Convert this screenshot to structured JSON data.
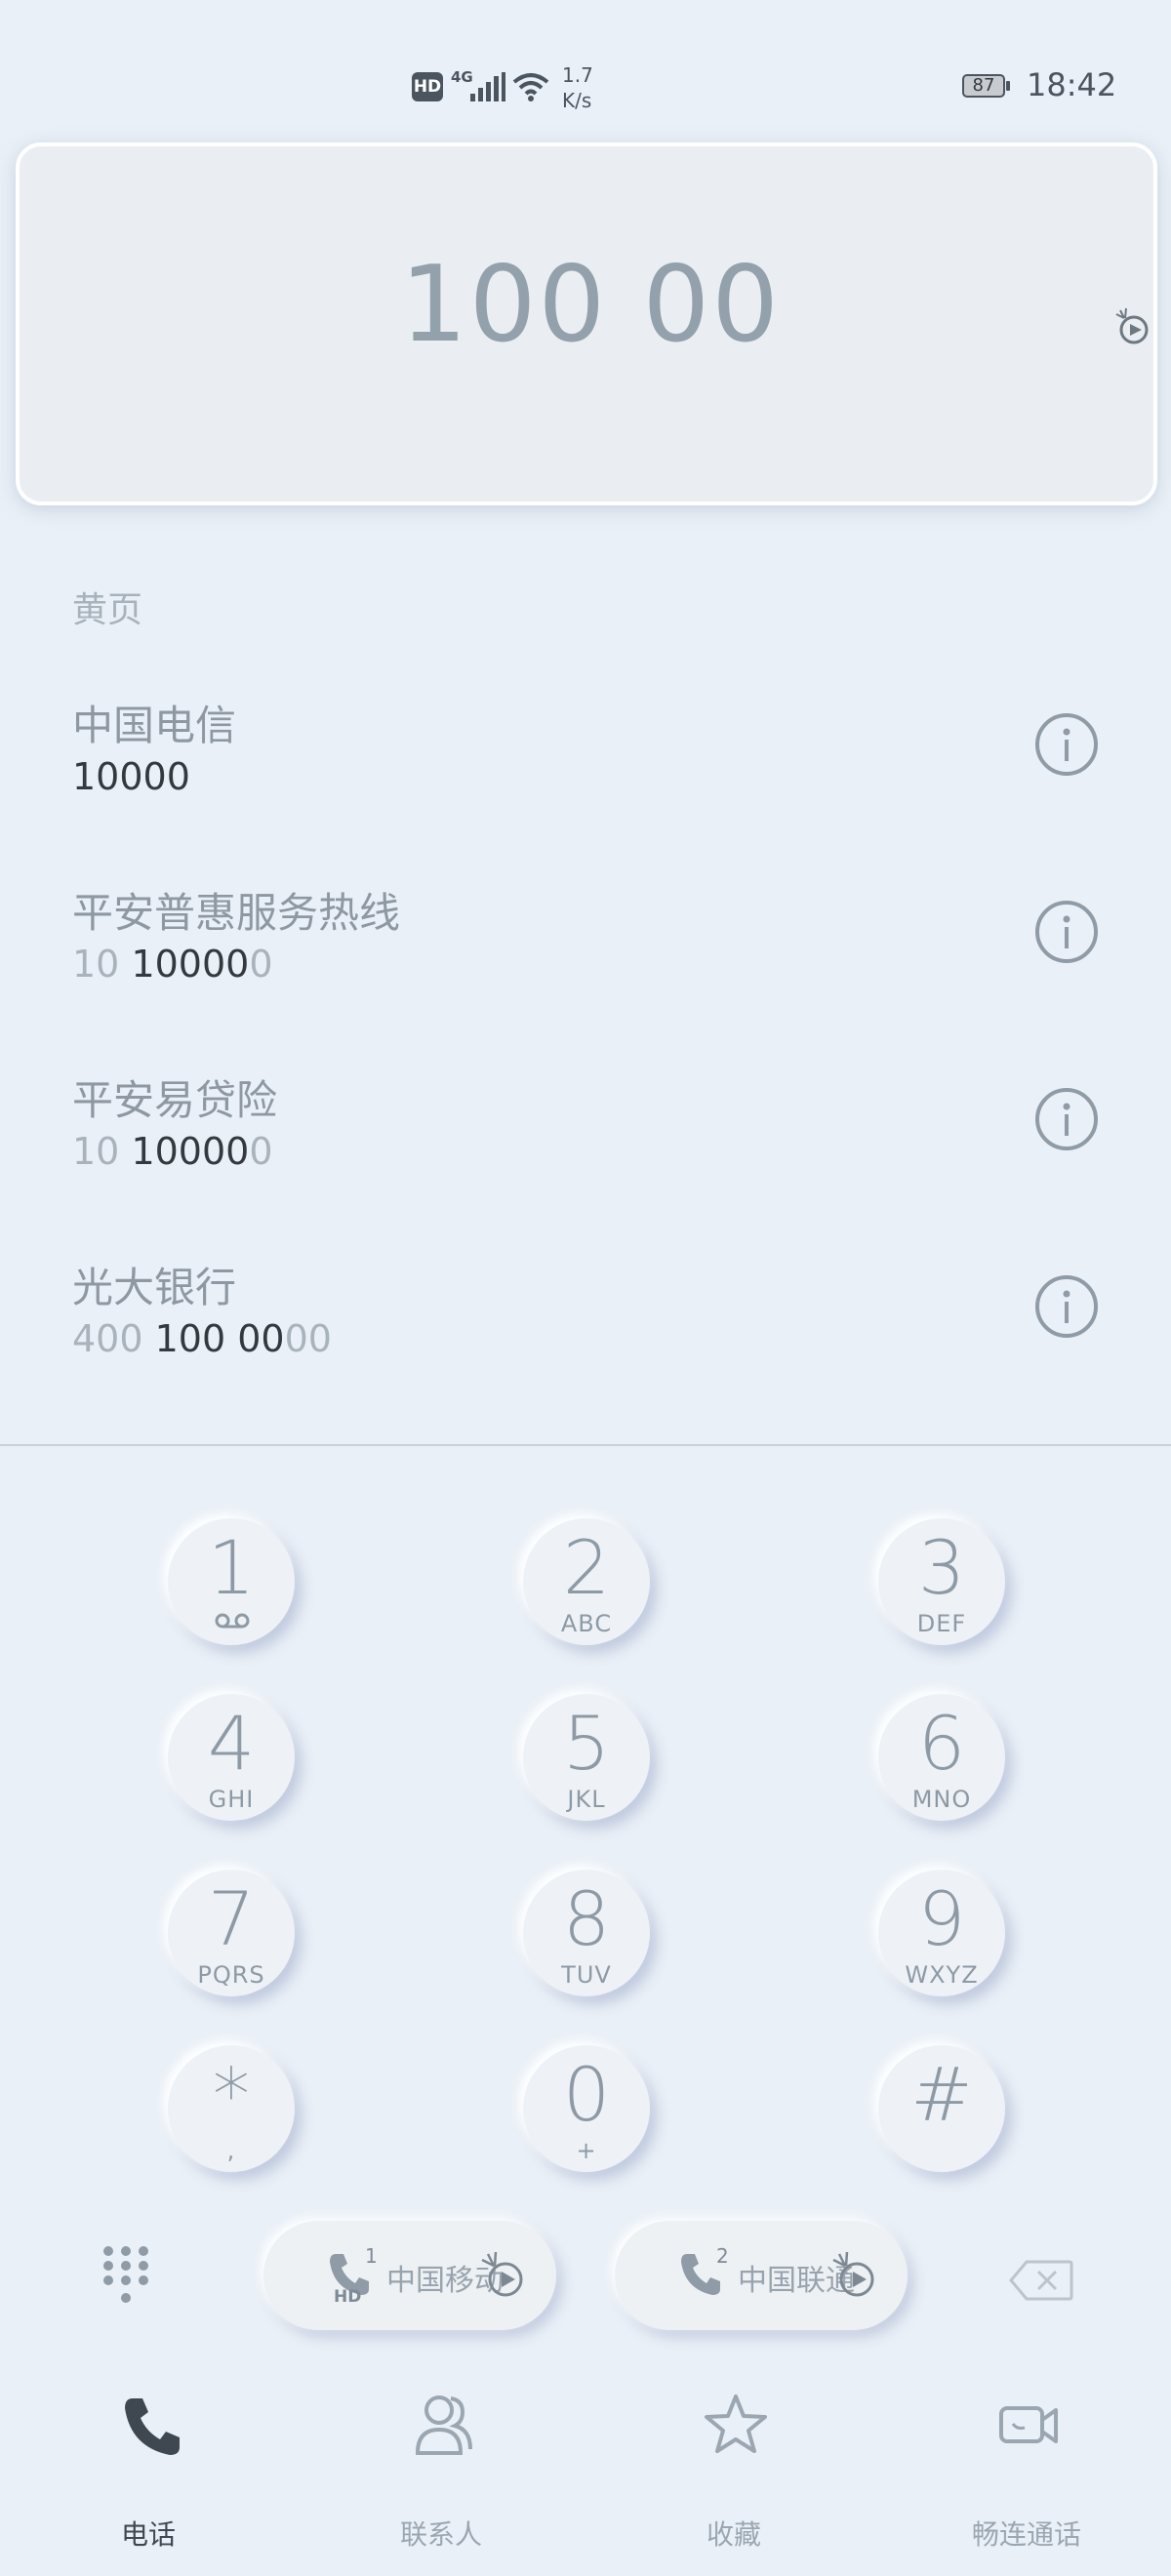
{
  "status_bar": {
    "hd": "HD",
    "network": "4G",
    "speed_value": "1.7",
    "speed_unit": "K/s",
    "battery": "87",
    "time": "18:42"
  },
  "dialer": {
    "dialed_number": "100 00"
  },
  "yellow_pages": {
    "title": "黄页",
    "entries": [
      {
        "name": "中国电信",
        "pre": "",
        "match": "10000",
        "post": ""
      },
      {
        "name": "平安普惠服务热线",
        "pre": "10 ",
        "match": "10000",
        "post": "0"
      },
      {
        "name": "平安易贷险",
        "pre": "10 ",
        "match": "10000",
        "post": "0"
      },
      {
        "name": "光大银行",
        "pre": "400 ",
        "match": "100 00",
        "post": "00"
      }
    ]
  },
  "keypad": {
    "keys": [
      {
        "digit": "1",
        "letters": ""
      },
      {
        "digit": "2",
        "letters": "ABC"
      },
      {
        "digit": "3",
        "letters": "DEF"
      },
      {
        "digit": "4",
        "letters": "GHI"
      },
      {
        "digit": "5",
        "letters": "JKL"
      },
      {
        "digit": "6",
        "letters": "MNO"
      },
      {
        "digit": "7",
        "letters": "PQRS"
      },
      {
        "digit": "8",
        "letters": "TUV"
      },
      {
        "digit": "9",
        "letters": "WXYZ"
      },
      {
        "digit": "*",
        "letters": ","
      },
      {
        "digit": "0",
        "letters": "+"
      },
      {
        "digit": "#",
        "letters": ""
      }
    ]
  },
  "call_buttons": [
    {
      "sim": "1",
      "hd": "HD",
      "carrier": "中国移动"
    },
    {
      "sim": "2",
      "hd": "",
      "carrier": "中国联通"
    }
  ],
  "bottom_nav": {
    "items": [
      {
        "label": "电话",
        "icon": "phone-icon",
        "active": true
      },
      {
        "label": "联系人",
        "icon": "contacts-icon",
        "active": false
      },
      {
        "label": "收藏",
        "icon": "star-icon",
        "active": false
      },
      {
        "label": "畅连通话",
        "icon": "video-call-icon",
        "active": false
      }
    ]
  },
  "colors": {
    "background": "#eaf0f7",
    "active_nav": "#3f4750",
    "muted_text": "#8f9ba6"
  }
}
